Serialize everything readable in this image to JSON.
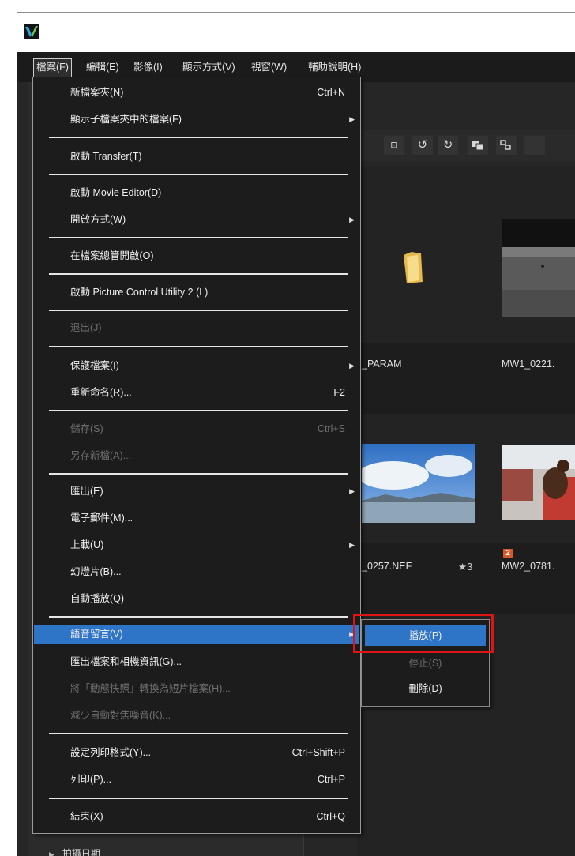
{
  "menubar": {
    "items": [
      "檔案(F)",
      "編輯(E)",
      "影像(I)",
      "顯示方式(V)",
      "視窗(W)",
      "輔助說明(H)"
    ]
  },
  "file_menu": {
    "items": [
      {
        "label": "新檔案夾(N)",
        "shortcut": "Ctrl+N"
      },
      {
        "label": "顯示子檔案夾中的檔案(F)",
        "submenu": true
      },
      {
        "label": "啟動 Transfer(T)"
      },
      {
        "label": "啟動 Movie Editor(D)"
      },
      {
        "label": "開啟方式(W)",
        "submenu": true
      },
      {
        "label": "在檔案總管開啟(O)"
      },
      {
        "label": "啟動 Picture Control Utility 2 (L)"
      },
      {
        "label": "退出(J)",
        "disabled": true
      },
      {
        "label": "保護檔案(I)",
        "submenu": true
      },
      {
        "label": "重新命名(R)...",
        "shortcut": "F2"
      },
      {
        "label": "儲存(S)",
        "shortcut": "Ctrl+S",
        "disabled": true
      },
      {
        "label": "另存新檔(A)...",
        "disabled": true
      },
      {
        "label": "匯出(E)",
        "submenu": true
      },
      {
        "label": "電子郵件(M)..."
      },
      {
        "label": "上載(U)",
        "submenu": true
      },
      {
        "label": "幻燈片(B)..."
      },
      {
        "label": "自動播放(Q)"
      },
      {
        "label": "語音留言(V)",
        "submenu": true,
        "highlighted": true
      },
      {
        "label": "匯出檔案和相機資訊(G)..."
      },
      {
        "label": "將「動態快照」轉換為短片檔案(H)...",
        "disabled": true
      },
      {
        "label": "減少自動對焦噪音(K)...",
        "disabled": true
      },
      {
        "label": "設定列印格式(Y)...",
        "shortcut": "Ctrl+Shift+P"
      },
      {
        "label": "列印(P)...",
        "shortcut": "Ctrl+P"
      },
      {
        "label": "結束(X)",
        "shortcut": "Ctrl+Q"
      }
    ]
  },
  "voice_memo_submenu": {
    "items": [
      {
        "label": "播放(P)",
        "highlighted": true
      },
      {
        "label": "停止(S)",
        "disabled": true
      },
      {
        "label": "刪除(D)"
      }
    ]
  },
  "tree": {
    "item": "拍攝日期"
  },
  "thumbnails": [
    {
      "caption": "_PARAM"
    },
    {
      "caption": "MW1_0221."
    },
    {
      "caption": "_0257.NEF",
      "rating": "★3"
    },
    {
      "caption": "MW2_0781.",
      "badge": "2"
    }
  ],
  "toolbar": {
    "icons": [
      "fit-screen-icon",
      "rotate-left-icon",
      "rotate-right-icon",
      "compare-icon",
      "multi-view-icon"
    ]
  },
  "colors": {
    "highlight": "#2f75c7",
    "callout_border": "#e01414",
    "menu_bg": "#1c1c1c"
  }
}
